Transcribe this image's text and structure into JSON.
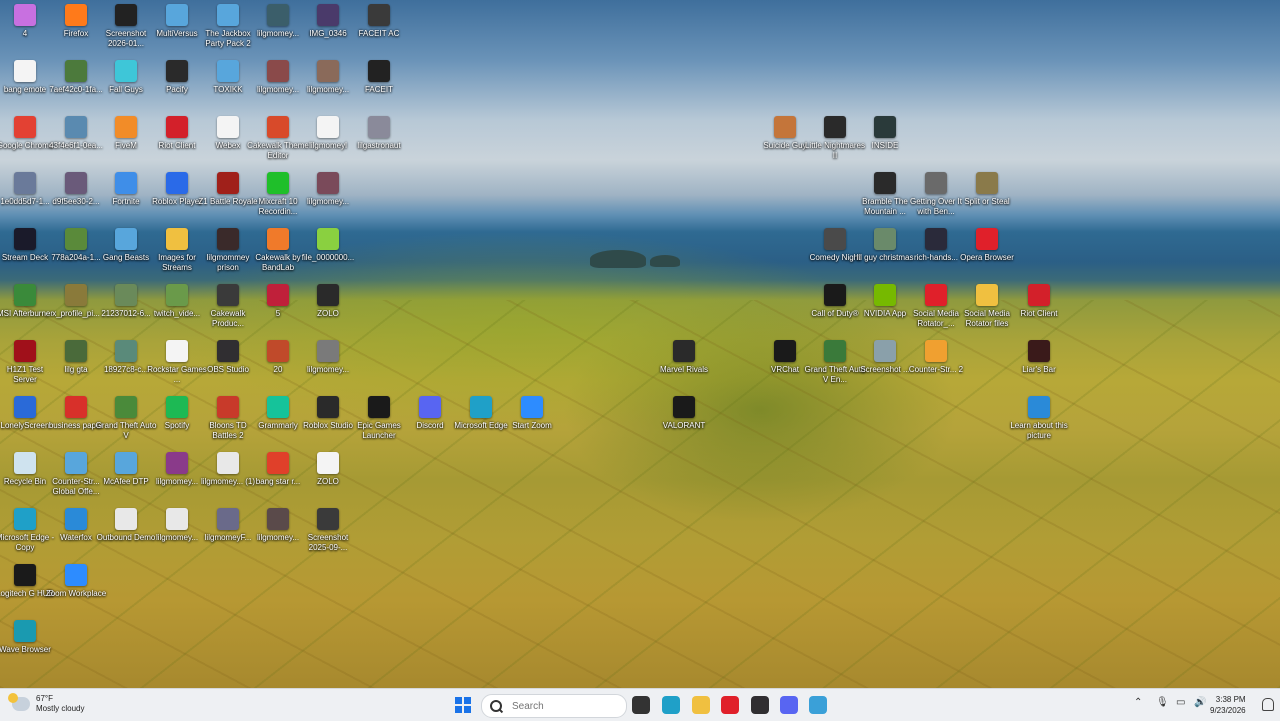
{
  "desktop": {
    "icons": [
      {
        "label": "4",
        "icon": "app-icon-4",
        "color": "#c870e0"
      },
      {
        "label": "Firefox",
        "icon": "firefox-icon",
        "color": "#ff7a1a"
      },
      {
        "label": "Screenshot 2026-01...",
        "icon": "screenshot-icon",
        "color": "#222222"
      },
      {
        "label": "MultiVersus",
        "icon": "internet-shortcut-icon",
        "color": "#58a6dc"
      },
      {
        "label": "The Jackbox Party Pack 2",
        "icon": "internet-shortcut-icon",
        "color": "#58a6dc"
      },
      {
        "label": "lilgmomey...",
        "icon": "image-icon",
        "color": "#3b5e6a"
      },
      {
        "label": "IMG_0346",
        "icon": "image-icon",
        "color": "#4a3a6a"
      },
      {
        "label": "FACEIT AC",
        "icon": "faceit-ac-icon",
        "color": "#3a3a3a"
      },
      {
        "label": "bang emote",
        "icon": "blank-file-icon",
        "color": "#f4f4f4"
      },
      {
        "label": "7aef42c0-1fa...",
        "icon": "image-icon",
        "color": "#4c7a3c"
      },
      {
        "label": "Fall Guys",
        "icon": "fall-guys-icon",
        "color": "#3ec6d8"
      },
      {
        "label": "Pacify",
        "icon": "pacify-icon",
        "color": "#2a2a2a"
      },
      {
        "label": "TOXIKK",
        "icon": "internet-shortcut-icon",
        "color": "#58a6dc"
      },
      {
        "label": "lilgmomey...",
        "icon": "image-icon",
        "color": "#8a4a4a"
      },
      {
        "label": "lilgmomey...",
        "icon": "image-icon",
        "color": "#8a6a5a"
      },
      {
        "label": "FACEIT",
        "icon": "faceit-icon",
        "color": "#222222"
      },
      {
        "label": "Google Chrome",
        "icon": "chrome-icon",
        "color": "#e34133"
      },
      {
        "label": "43f4e6f1-0ea...",
        "icon": "image-icon",
        "color": "#5a8ab0"
      },
      {
        "label": "FiveM",
        "icon": "fivem-icon",
        "color": "#f28c28"
      },
      {
        "label": "Riot Client",
        "icon": "riot-client-icon",
        "color": "#d3202a"
      },
      {
        "label": "Webex",
        "icon": "blank-file-icon",
        "color": "#f4f4f4"
      },
      {
        "label": "Cakewalk Theme Editor",
        "icon": "cakewalk-icon",
        "color": "#d84a2a"
      },
      {
        "label": "lilgmomeyl",
        "icon": "text-file-icon",
        "color": "#f4f4f4"
      },
      {
        "label": "lilgastronaut",
        "icon": "image-icon",
        "color": "#8a8a9a"
      },
      {
        "label": "Suicide Guy",
        "icon": "suicide-guy-icon",
        "color": "#c4753a"
      },
      {
        "label": "Little Nightmares II",
        "icon": "little-nightmares-icon",
        "color": "#2a2a2a"
      },
      {
        "label": "INSIDE",
        "icon": "inside-icon",
        "color": "#2a3a3a"
      },
      {
        "label": "1e0dd5d7-1...",
        "icon": "image-icon",
        "color": "#6a7a9a"
      },
      {
        "label": "d9f5ee30-2...",
        "icon": "image-icon",
        "color": "#6a5a7a"
      },
      {
        "label": "Fortnite",
        "icon": "fortnite-icon",
        "color": "#3f8ee8"
      },
      {
        "label": "Roblox Player",
        "icon": "roblox-icon",
        "color": "#2a6ae8"
      },
      {
        "label": "Z1 Battle Royale",
        "icon": "z1-icon",
        "color": "#a0201a"
      },
      {
        "label": "Mixcraft 10 Recordin...",
        "icon": "mixcraft-icon",
        "color": "#1fbf2a"
      },
      {
        "label": "lilgmomey...",
        "icon": "image-icon",
        "color": "#7a4a5a"
      },
      {
        "label": "Bramble The Mountain ...",
        "icon": "bramble-icon",
        "color": "#2a2a2a"
      },
      {
        "label": "Getting Over It with Ben...",
        "icon": "getting-over-it-icon",
        "color": "#6a6a6a"
      },
      {
        "label": "Split or Steal",
        "icon": "split-or-steal-icon",
        "color": "#8a7a4a"
      },
      {
        "label": "Stream Deck",
        "icon": "stream-deck-icon",
        "color": "#1a1a2a"
      },
      {
        "label": "778a204a-1...",
        "icon": "image-icon",
        "color": "#5a8a3a"
      },
      {
        "label": "Gang Beasts",
        "icon": "internet-shortcut-icon",
        "color": "#58a6dc"
      },
      {
        "label": "Images for Streams",
        "icon": "folder-icon",
        "color": "#f0c040"
      },
      {
        "label": "lilgmommey prison",
        "icon": "image-icon",
        "color": "#3a2a2a"
      },
      {
        "label": "Cakewalk by BandLab",
        "icon": "cakewalk-icon",
        "color": "#f07a2a"
      },
      {
        "label": "file_0000000...",
        "icon": "image-icon",
        "color": "#8ad040"
      },
      {
        "label": "Comedy Night",
        "icon": "comedy-night-icon",
        "color": "#4a4a4a"
      },
      {
        "label": "lil guy christmas",
        "icon": "image-icon",
        "color": "#6a8a6a"
      },
      {
        "label": "rich-hands...",
        "icon": "image-icon",
        "color": "#2a2a3a"
      },
      {
        "label": "Opera Browser",
        "icon": "opera-icon",
        "color": "#e0202a"
      },
      {
        "label": "MSI Afterburner",
        "icon": "msi-afterburner-icon",
        "color": "#3a8a3a"
      },
      {
        "label": "x_profile_pi...",
        "icon": "image-icon",
        "color": "#8a7a3a"
      },
      {
        "label": "21237012-6...",
        "icon": "image-icon",
        "color": "#6a8a5a"
      },
      {
        "label": "twitch_vide...",
        "icon": "image-icon",
        "color": "#6a9a4a"
      },
      {
        "label": "Cakewalk Produc...",
        "icon": "cakewalk-icon",
        "color": "#3a3a3a"
      },
      {
        "label": "5",
        "icon": "image-icon",
        "color": "#c0203a"
      },
      {
        "label": "ZOLO",
        "icon": "image-icon",
        "color": "#2a2a2a"
      },
      {
        "label": "Call of Duty®",
        "icon": "call-of-duty-icon",
        "color": "#1a1a1a"
      },
      {
        "label": "NVIDIA App",
        "icon": "nvidia-icon",
        "color": "#76b900"
      },
      {
        "label": "Social Media Rotator_...",
        "icon": "opera-icon",
        "color": "#e0202a"
      },
      {
        "label": "Social Media Rotator files",
        "icon": "folder-icon",
        "color": "#f0c040"
      },
      {
        "label": "Riot Client",
        "icon": "riot-client-icon",
        "color": "#d3202a"
      },
      {
        "label": "H1Z1 Test Server",
        "icon": "h1z1-icon",
        "color": "#a0101a"
      },
      {
        "label": "lilg gta",
        "icon": "image-icon",
        "color": "#4a6a3a"
      },
      {
        "label": "18927c8-c...",
        "icon": "image-icon",
        "color": "#5a8a7a"
      },
      {
        "label": "Rockstar Games ...",
        "icon": "blank-file-icon",
        "color": "#f4f4f4"
      },
      {
        "label": "OBS Studio",
        "icon": "obs-icon",
        "color": "#302e31"
      },
      {
        "label": "20",
        "icon": "image-icon",
        "color": "#c04a2a"
      },
      {
        "label": "lilgmomey...",
        "icon": "image-icon",
        "color": "#7a7a7a"
      },
      {
        "label": "Marvel Rivals",
        "icon": "marvel-rivals-icon",
        "color": "#2a2a2a"
      },
      {
        "label": "VRChat",
        "icon": "vrchat-icon",
        "color": "#1a1a1a"
      },
      {
        "label": "Grand Theft Auto V En...",
        "icon": "gta-icon",
        "color": "#3a7a3a"
      },
      {
        "label": "Screenshot ...",
        "icon": "screenshot-icon",
        "color": "#8aa0aa"
      },
      {
        "label": "Counter-Str... 2",
        "icon": "counter-strike-icon",
        "color": "#f0a030"
      },
      {
        "label": "Liar's Bar",
        "icon": "liars-bar-icon",
        "color": "#3a1a1a"
      },
      {
        "label": "LonelyScreen",
        "icon": "lonelyscreen-icon",
        "color": "#2a6ad8"
      },
      {
        "label": "business paper",
        "icon": "pdf-icon",
        "color": "#d8302a"
      },
      {
        "label": "Grand Theft Auto V",
        "icon": "gta-icon",
        "color": "#4a8a3a"
      },
      {
        "label": "Spotify",
        "icon": "spotify-icon",
        "color": "#1db954"
      },
      {
        "label": "Bloons TD Battles 2",
        "icon": "bloons-icon",
        "color": "#c83a2a"
      },
      {
        "label": "Grammarly",
        "icon": "grammarly-icon",
        "color": "#15c39a"
      },
      {
        "label": "Roblox Studio",
        "icon": "roblox-studio-icon",
        "color": "#2a2a2a"
      },
      {
        "label": "Epic Games Launcher",
        "icon": "epic-games-icon",
        "color": "#1a1a1a"
      },
      {
        "label": "Discord",
        "icon": "discord-icon",
        "color": "#5865f2"
      },
      {
        "label": "Microsoft Edge",
        "icon": "edge-icon",
        "color": "#1fa0c8"
      },
      {
        "label": "Start Zoom",
        "icon": "zoom-icon",
        "color": "#2d8cff"
      },
      {
        "label": "VALORANT",
        "icon": "valorant-icon",
        "color": "#1a1a1a"
      },
      {
        "label": "Learn about this picture",
        "icon": "learn-about-icon",
        "color": "#2a8ad8"
      },
      {
        "label": "Recycle Bin",
        "icon": "recycle-bin-icon",
        "color": "#cfe3ef"
      },
      {
        "label": "Counter-Str... Global Offe...",
        "icon": "internet-shortcut-icon",
        "color": "#58a6dc"
      },
      {
        "label": "McAfee DTP",
        "icon": "internet-shortcut-icon",
        "color": "#58a6dc"
      },
      {
        "label": "lilgmomey...",
        "icon": "image-icon",
        "color": "#8a3a8a"
      },
      {
        "label": "lilgmomey... (1)",
        "icon": "image-icon",
        "color": "#e8e8e8"
      },
      {
        "label": "bang star r...",
        "icon": "image-icon",
        "color": "#e0402a"
      },
      {
        "label": "ZOLO",
        "icon": "blank-file-icon",
        "color": "#f4f4f4"
      },
      {
        "label": "Microsoft Edge - Copy",
        "icon": "edge-icon",
        "color": "#1fa0c8"
      },
      {
        "label": "Waterfox",
        "icon": "waterfox-icon",
        "color": "#2a8ad8"
      },
      {
        "label": "Outbound Demo",
        "icon": "outbound-icon",
        "color": "#e8e8e8"
      },
      {
        "label": "lilgmomey...",
        "icon": "image-icon",
        "color": "#e8e8e8"
      },
      {
        "label": "lilgmomeyF...",
        "icon": "image-icon",
        "color": "#6a6a8a"
      },
      {
        "label": "lilgmomey...",
        "icon": "image-icon",
        "color": "#5a4a4a"
      },
      {
        "label": "Screenshot 2025-09-...",
        "icon": "screenshot-icon",
        "color": "#3a3a3a"
      },
      {
        "label": "Logitech G HUB",
        "icon": "logitech-icon",
        "color": "#1a1a1a"
      },
      {
        "label": "Zoom Workplace",
        "icon": "zoom-icon",
        "color": "#2d8cff"
      },
      {
        "label": "Wave Browser",
        "icon": "wave-browser-icon",
        "color": "#1a9ab0"
      }
    ]
  },
  "taskbar": {
    "weather": {
      "temp": "67°F",
      "condition": "Mostly cloudy"
    },
    "search_placeholder": "Search",
    "clock": {
      "time": "3:38 PM",
      "date": "9/23/2026"
    },
    "apps": [
      {
        "icon": "task-view-icon",
        "color": "#333333"
      },
      {
        "icon": "edge-icon",
        "color": "#1fa0c8"
      },
      {
        "icon": "file-explorer-icon",
        "color": "#f0c040"
      },
      {
        "icon": "opera-icon",
        "color": "#e0202a"
      },
      {
        "icon": "obs-icon",
        "color": "#302e31"
      },
      {
        "icon": "discord-icon",
        "color": "#5865f2"
      },
      {
        "icon": "notepad-icon",
        "color": "#3aa0d8"
      }
    ]
  }
}
